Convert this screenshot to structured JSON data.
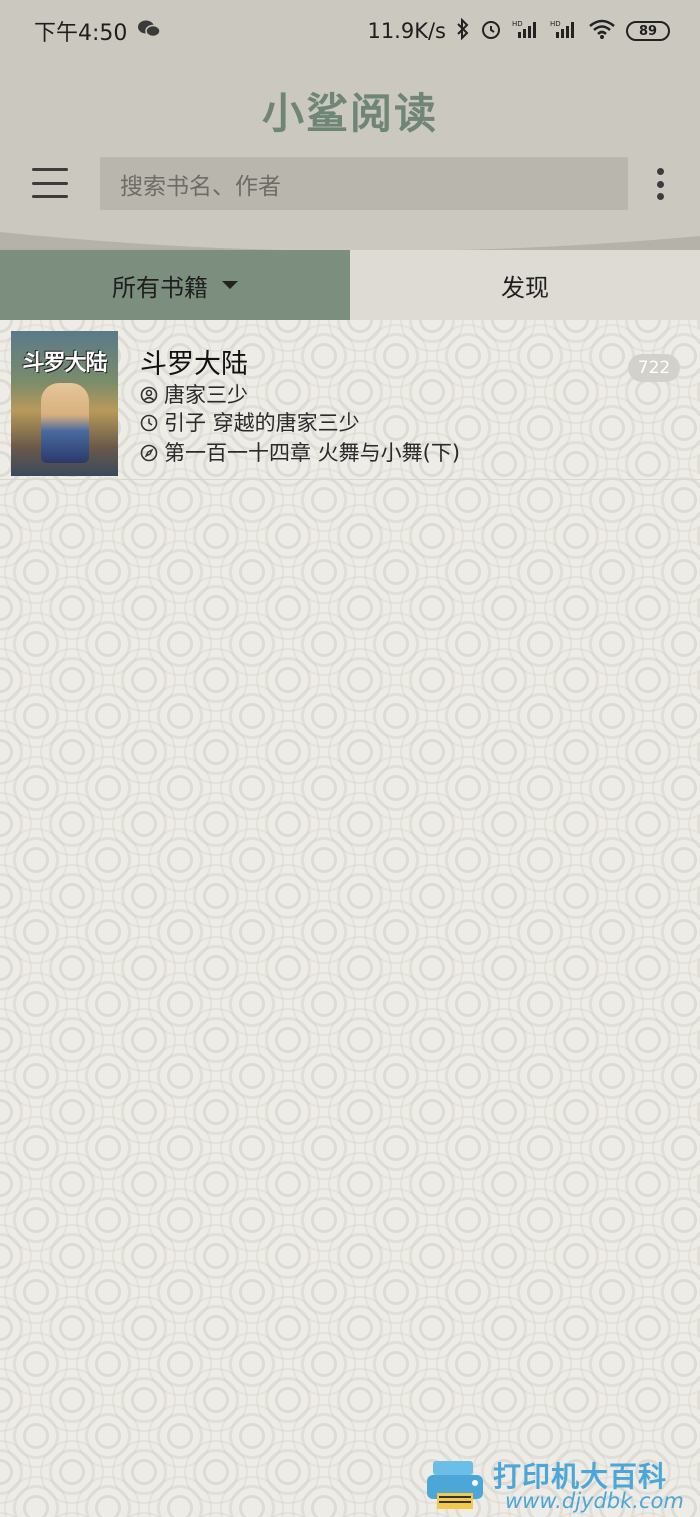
{
  "status_bar": {
    "time": "下午4:50",
    "network_speed": "11.9K/s",
    "battery": "89"
  },
  "header": {
    "app_title": "小鲨阅读",
    "search_placeholder": "搜索书名、作者"
  },
  "tabs": [
    {
      "label": "所有书籍",
      "active": true
    },
    {
      "label": "发现",
      "active": false
    }
  ],
  "books": [
    {
      "title": "斗罗大陆",
      "cover_text": "斗罗大陆",
      "author": "唐家三少",
      "last_read": "引子 穿越的唐家三少",
      "latest_chapter": "第一百一十四章 火舞与小舞(下)",
      "unread_count": "722"
    }
  ],
  "watermark": {
    "text": "打印机大百科",
    "url": "www.djydbk.com"
  },
  "colors": {
    "header_bg": "#cbc8c0",
    "accent_green": "#7c8f7f",
    "title_green": "#6f8576"
  }
}
